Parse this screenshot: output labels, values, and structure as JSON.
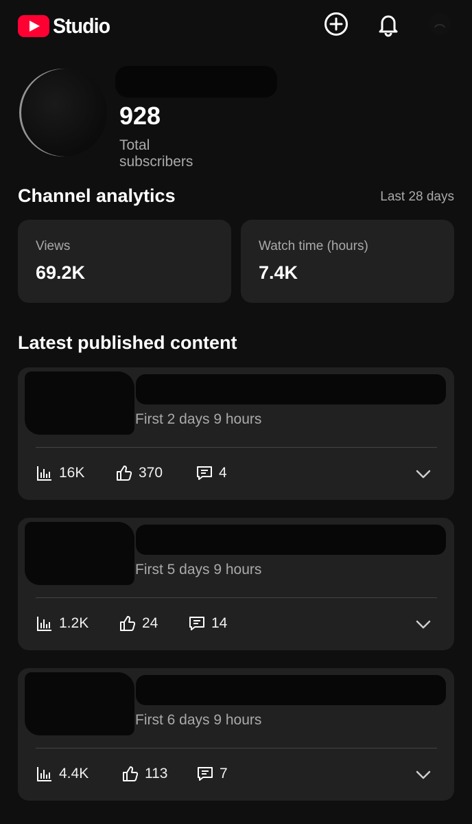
{
  "app": {
    "brand": "Studio",
    "accent": "#ff0033"
  },
  "header": {
    "icons": [
      "create-icon",
      "notifications-icon",
      "account-avatar"
    ]
  },
  "channel": {
    "subscribers": "928",
    "subscribers_label": "Total subscribers"
  },
  "analytics": {
    "title": "Channel analytics",
    "period": "Last 28 days",
    "metrics": [
      {
        "label": "Views",
        "value": "69.2K"
      },
      {
        "label": "Watch time (hours)",
        "value": "7.4K"
      }
    ]
  },
  "latest": {
    "title": "Latest published content",
    "items": [
      {
        "duration": "First 2 days 9 hours",
        "views": "16K",
        "likes": "370",
        "comments": "4"
      },
      {
        "duration": "First 5 days 9 hours",
        "views": "1.2K",
        "likes": "24",
        "comments": "14"
      },
      {
        "duration": "First 6 days 9 hours",
        "views": "4.4K",
        "likes": "113",
        "comments": "7"
      }
    ]
  }
}
